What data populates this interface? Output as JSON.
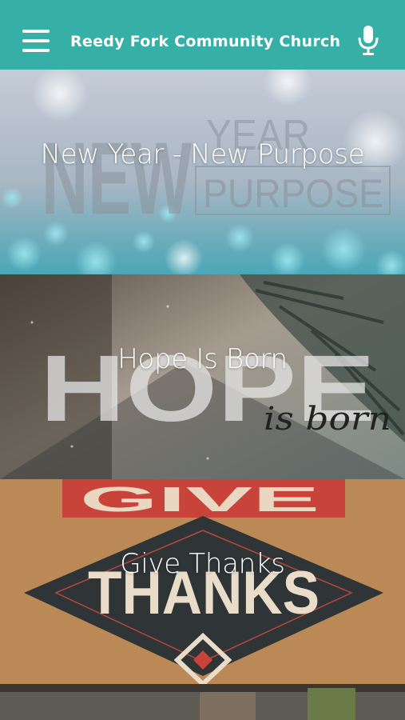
{
  "header": {
    "title": "Reedy Fork Community Church",
    "menu_icon": "hamburger-menu-icon",
    "mic_icon": "microphone-icon"
  },
  "colors": {
    "header_bg": "#36b0a6",
    "text": "#ffffff"
  },
  "series": [
    {
      "title": "New Year - New Purpose",
      "art_text": {
        "line1": "NEW",
        "line2": "YEAR",
        "line3": "PURPOSE"
      }
    },
    {
      "title": "Hope Is Born",
      "art_text": {
        "line1": "HOPE",
        "line2": "is born"
      }
    },
    {
      "title": "Give Thanks",
      "art_text": {
        "line1": "GIVE",
        "line2": "THANKS"
      }
    }
  ]
}
